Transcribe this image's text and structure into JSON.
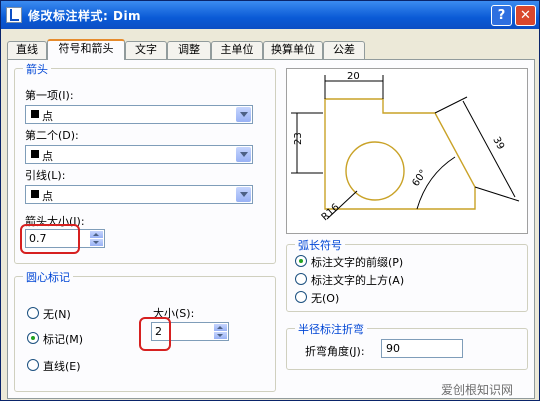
{
  "window": {
    "title": "修改标注样式: Dim",
    "help_label": "?",
    "close_label": "✕"
  },
  "tabs": [
    {
      "label": "直线"
    },
    {
      "label": "符号和箭头"
    },
    {
      "label": "文字"
    },
    {
      "label": "调整"
    },
    {
      "label": "主单位"
    },
    {
      "label": "换算单位"
    },
    {
      "label": "公差"
    }
  ],
  "arrowheads": {
    "title": "箭头",
    "first_label": "第一项(I):",
    "first_value": "点",
    "second_label": "第二个(D):",
    "second_value": "点",
    "leader_label": "引线(L):",
    "leader_value": "点",
    "size_label": "箭头大小(I):",
    "size_value": "0.7"
  },
  "center_marks": {
    "title": "圆心标记",
    "none_label": "无(N)",
    "mark_label": "标记(M)",
    "line_label": "直线(E)",
    "selected": "mark",
    "size_label": "大小(S):",
    "size_value": "2"
  },
  "preview": {
    "dim_20": "20",
    "dim_23": "23",
    "dim_39": "39",
    "dim_angle": "60°",
    "dim_radius": "R16"
  },
  "arc_length": {
    "title": "弧长符号",
    "option1": "标注文字的前缀(P)",
    "option2": "标注文字的上方(A)",
    "option3": "无(O)",
    "selected": "option1"
  },
  "radius_jog": {
    "title": "半径标注折弯",
    "angle_label": "折弯角度(J):",
    "angle_value": "90"
  },
  "watermark": "爱创根知识网",
  "colors": {
    "group_title": "#0046d5",
    "highlight": "#d62020",
    "tab_active": "#e68b2c",
    "preview_geometry": "#c9a227"
  },
  "icons": {
    "dropdown": "chevron-down-icon",
    "spinner": "spinner-arrows-icon",
    "help": "help-icon",
    "close": "close-icon",
    "app": "autocad-icon"
  }
}
